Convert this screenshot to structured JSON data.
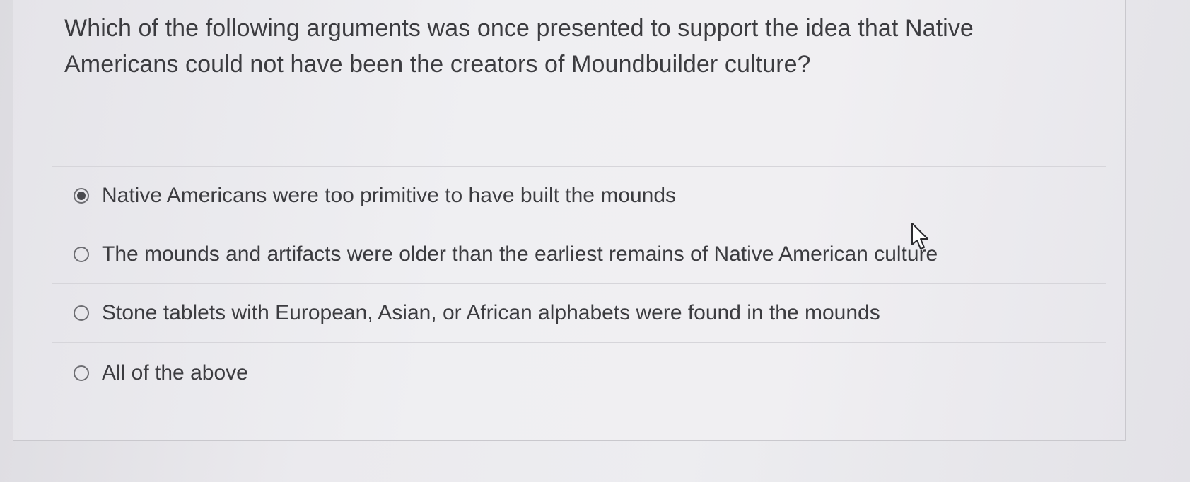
{
  "question": {
    "text": "Which of the following arguments was once presented to support the idea that Native Americans could not have been the creators of Moundbuilder culture?"
  },
  "options": [
    {
      "label": "Native Americans were too primitive to have built the mounds",
      "selected": true
    },
    {
      "label": "The mounds and artifacts were older than the earliest remains of Native American culture",
      "selected": false
    },
    {
      "label": "Stone tablets with European, Asian, or African alphabets were found in the mounds",
      "selected": false
    },
    {
      "label": "All of the above",
      "selected": false
    }
  ],
  "icons": {
    "cursor": "arrow-cursor-icon",
    "radio_selected": "radio-selected-icon",
    "radio_unselected": "radio-unselected-icon"
  },
  "colors": {
    "text": "#3c3c40",
    "radio_border": "#6d6d72",
    "radio_fill": "#4a4a4f",
    "divider": "#d6d5da"
  }
}
